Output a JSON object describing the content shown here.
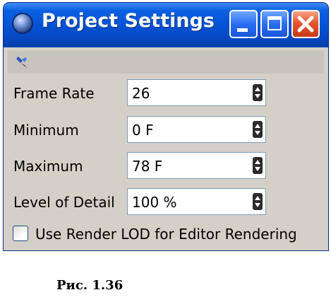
{
  "window": {
    "title": "Project Settings",
    "icons": {
      "app": "cinema4d-sphere-icon",
      "minimize": "minimize-icon",
      "maximize": "maximize-icon",
      "close": "close-icon",
      "pin": "pin-icon",
      "stepper": "spin-arrows-icon"
    }
  },
  "settings": {
    "frame_rate": {
      "label": "Frame Rate",
      "value": "26"
    },
    "minimum": {
      "label": "Minimum",
      "value": "0 F"
    },
    "maximum": {
      "label": "Maximum",
      "value": "78 F"
    },
    "level_of_detail": {
      "label": "Level of Detail",
      "value": "100 %"
    }
  },
  "use_render_lod": {
    "label": "Use Render LOD for Editor Rendering",
    "checked": false
  },
  "caption": "Рис. 1.36",
  "colors": {
    "titlebar": "#0553d6",
    "close_button": "#e5572f",
    "panel": "#d4d0c8"
  }
}
